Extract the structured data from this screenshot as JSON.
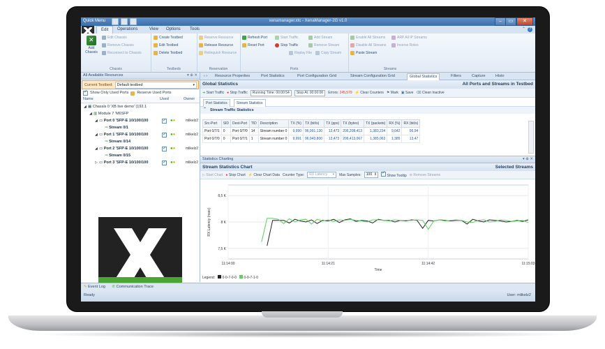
{
  "window": {
    "title": "xenamanager.xtc - XenaManager-2G v1.0",
    "quick_menu": "Quick Menu"
  },
  "menu": {
    "tabs": [
      "Edit",
      "Operations",
      "View",
      "Options",
      "Tools"
    ],
    "active": "Edit"
  },
  "ribbon": {
    "chassis": {
      "big_button": "Add Chassis",
      "items": [
        "Edit Chassis",
        "Remove Chassis",
        "Reconnect to Chassis"
      ],
      "label": "Chassis"
    },
    "testbeds": {
      "items": [
        "Create Testbed",
        "Edit Testbed",
        "Delete Testbed"
      ],
      "label": "Testbeds"
    },
    "reservation": {
      "items": [
        "Reserve Resource",
        "Release Resource",
        "Relinquish Resource"
      ],
      "label": "Reservation"
    },
    "ports": {
      "items": [
        "Refresh Port",
        "Reset Port",
        "Start Traffic",
        "Stop Traffic",
        "Add Stream",
        "Remove Stream",
        "Replay File",
        "Copy Stream"
      ],
      "label": "Ports"
    },
    "streams": {
      "items": [
        "Enable All Streams",
        "Disable All Streams",
        "Paste Stream",
        "ARP All IP Streams",
        "Inverse Roles"
      ],
      "label": "Streams"
    }
  },
  "left_panel": {
    "title": "All Available Resources",
    "current_testbed_label": "Current Testbed:",
    "current_testbed_value": "Default testbed",
    "show_only_used": "Show Only Used Ports",
    "reserve_used": "Reserve Used Ports",
    "columns": [
      "Name",
      "Used",
      "Owner"
    ],
    "tree": [
      {
        "label": "Chassis 0 'XB live demo' (192.1",
        "level": 0,
        "expander": "◢"
      },
      {
        "label": "Module 7 'M6SFP",
        "level": 1,
        "expander": "◢"
      },
      {
        "label": "Port 0 'SFP-E 10/100/100",
        "level": 2,
        "expander": "◢",
        "port": true,
        "owner": "mlikelz2"
      },
      {
        "label": "Stream 0/1",
        "level": 3,
        "expander": ""
      },
      {
        "label": "Port 1 'SFP-E 10/100/100",
        "level": 2,
        "expander": "◢",
        "port": true,
        "owner": "mlikelz2"
      },
      {
        "label": "Stream 0/14",
        "level": 3,
        "expander": ""
      },
      {
        "label": "Port 2 'SFP-E 10/100/100",
        "level": 2,
        "expander": "◢",
        "port": true,
        "owner": "mlikelz2"
      },
      {
        "label": "Stream 0/15",
        "level": 3,
        "expander": ""
      },
      {
        "label": "Port 3 'SFP-E 10/100/100",
        "level": 2,
        "expander": "▷",
        "port": true,
        "owner": "mlikelz2"
      }
    ]
  },
  "doc_tabs": [
    "Resource Properties",
    "Port Statistics",
    "Port Configuration Grid",
    "Stream Configuration Grid",
    "Global Statistics",
    "Filters",
    "Capture",
    "Histo"
  ],
  "doc_tabs_active": "Global Statistics",
  "global_stats": {
    "title": "Global Statistics",
    "scope": "All Ports and Streams in Testbed",
    "toolbar": {
      "start": "Start Traffic",
      "stop": "Stop Traffic",
      "running_time_label": "Running Time:",
      "running_time": "00:00:54",
      "stop_at_label": "Stop At:",
      "stop_at": "00:00:00",
      "errors_label": "Errors:",
      "errors": "245,579",
      "clear": "Clear Counters",
      "mark": "Mark",
      "save": "Save",
      "clean": "Clean Inactive"
    },
    "subtabs": [
      "Port Statistics",
      "Stream Statistics"
    ],
    "subtabs_active": "Stream Statistics",
    "section": "Stream Traffic Statistics",
    "columns": [
      "Src-Port",
      "SID",
      "Dest-Port",
      "TID",
      "Description",
      "TX (%)",
      "TX (bit/s)",
      "TX (pps)",
      "TX (bytes)",
      "TX (packets)",
      "RX (%)",
      "RX (bit/s)"
    ],
    "rows": [
      [
        "Port 0/7/1",
        "0",
        "Port 0/7/0",
        "14",
        "Stream number 0",
        "9,990",
        "96,991,130",
        "13,473",
        "206,208,413",
        "1,383,234",
        "9,642",
        "96,94"
      ],
      [
        "Port 0/7/0",
        "0",
        "Port 0/7/1",
        "1",
        "Stream number 0",
        "9,991",
        "96,943,800",
        "13,473",
        "206,413,067",
        "1,385,063",
        "1,385",
        "13,47"
      ]
    ]
  },
  "chart_panel": {
    "header": "Statistics Charting",
    "title": "Stream Statistics Chart",
    "scope": "Selected Streams",
    "toolbar": {
      "start": "Start Chart",
      "stop": "Stop Chart",
      "clear": "Clear Chart Data",
      "counter_label": "Counter Type:",
      "counter_value": "RX Latency",
      "max_label": "Max Samples:",
      "max_value": "100",
      "tooltip": "Show Tooltip",
      "remove": "Remove Streams"
    },
    "legend_label": "Legend:",
    "legend": [
      {
        "name": "0-0-7-0-0",
        "color": "#222222"
      },
      {
        "name": "0-0-7-1-0",
        "color": "#5bd15b"
      }
    ]
  },
  "chart_data": {
    "type": "line",
    "ylabel": "RX Latency (nsec)",
    "xlabel": "Time",
    "y_ticks": [
      "8,5 K",
      "8 K",
      "7,5 K"
    ],
    "x_ticks": [
      "11:14:00",
      "11:14:21",
      "11:14:42",
      "11:15:03"
    ],
    "grid": true,
    "series": [
      {
        "name": "0-0-7-0-0",
        "color": "#222222",
        "values": [
          null,
          null,
          null,
          null,
          null,
          null,
          null,
          7.55,
          8.03,
          8.03,
          8.03,
          7.98,
          8.05,
          8.02,
          8.0,
          8.04,
          7.97,
          8.03,
          8.02,
          8.05,
          7.99,
          8.04,
          8.06,
          8.01,
          8.03,
          8.02,
          7.98,
          8.05,
          8.03,
          8.03,
          8.0,
          8.03,
          8.02,
          8.04,
          8.03,
          7.88,
          8.03,
          8.02,
          8.04,
          8.03,
          8.02,
          8.03,
          8.03,
          7.96,
          8.05,
          8.02,
          8.0,
          8.04,
          8.03,
          8.02,
          8.0,
          8.01,
          8.03,
          8.01,
          8.04
        ]
      },
      {
        "name": "0-0-7-1-0",
        "color": "#5bd15b",
        "values": [
          null,
          null,
          null,
          null,
          null,
          null,
          7.62,
          8.07,
          8.07,
          8.05,
          7.97,
          8.06,
          8.0,
          8.04,
          8.05,
          7.96,
          8.05,
          8.02,
          8.04,
          8.01,
          8.04,
          8.03,
          8.05,
          8.03,
          8.02,
          8.0,
          8.04,
          8.04,
          8.03,
          8.02,
          8.04,
          8.03,
          8.03,
          8.03,
          8.04,
          8.03,
          7.86,
          8.02,
          8.04,
          8.02,
          8.03,
          8.04,
          8.03,
          8.0,
          7.99,
          8.03,
          8.04,
          8.0,
          8.01,
          8.04,
          8.03,
          8.01,
          8.02,
          8.03,
          7.99
        ]
      }
    ],
    "ylim": [
      7.3,
      8.7
    ]
  },
  "footer": {
    "event_log": "Event Log",
    "comm_trace": "Communication Trace",
    "status": "Ready",
    "user": "User: mlikelz2"
  }
}
